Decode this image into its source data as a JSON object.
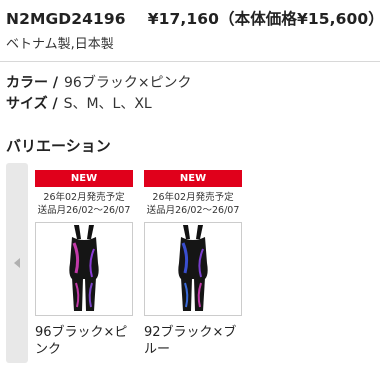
{
  "product": {
    "code": "N2MGD24196",
    "price": "¥17,160（本体価格¥15,600）",
    "origin": "ベトナム製,日本製"
  },
  "specs": {
    "color_label": "カラー /",
    "color_value": "96ブラック×ピンク",
    "size_label": "サイズ /",
    "size_value": "S、M、L、XL"
  },
  "variation": {
    "title": "バリエーション",
    "prev_icon": "chevron-left-icon",
    "items": [
      {
        "badge": "NEW",
        "release": "26年02月発売予定",
        "ship": "送品月26/02〜26/07",
        "name": "96ブラック×ピンク",
        "accent": "#c23aa8"
      },
      {
        "badge": "NEW",
        "release": "26年02月発売予定",
        "ship": "送品月26/02〜26/07",
        "name": "92ブラック×ブルー",
        "accent": "#3a4fd0"
      }
    ]
  },
  "colors": {
    "badge": "#e0001b",
    "scroll_bg": "#e8e8e8"
  }
}
